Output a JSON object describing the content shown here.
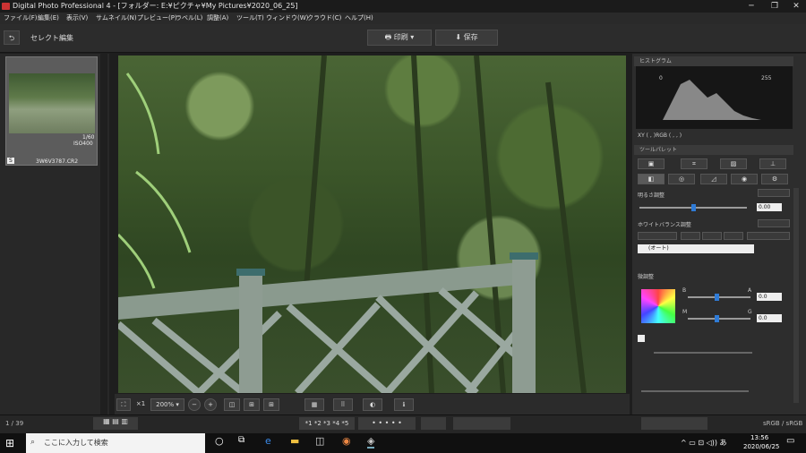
{
  "window": {
    "title": "Digital Photo Professional 4 - [フォルダー: E:¥ピクチャ¥My Pictures¥2020_06_25]"
  },
  "menu": [
    "ファイル(F)",
    "編集(E)",
    "表示(V)",
    "サムネイル(N)",
    "プレビュー(P)",
    "ラベル(L)",
    "調整(A)",
    "ツール(T)",
    "ウィンドウ(W)",
    "クラウド(C)",
    "ヘルプ(H)"
  ],
  "toolbar": {
    "mode_label": "セレクト編集",
    "print_label": "印刷",
    "save_label": "保存"
  },
  "thumbnail": {
    "filename": "3W6V3787.CR2",
    "shutter": "1/60",
    "iso": "ISO400",
    "badge": "S"
  },
  "histogram": {
    "title": "ヒストグラム",
    "min_label": "0",
    "max_label": "255",
    "xy_text": "XY (    ,     )RGB (    ,    ,    )"
  },
  "tool_palette": {
    "title": "ツールパレット"
  },
  "brightness": {
    "label": "明るさ調整",
    "value": "0.00",
    "level": 0.5
  },
  "white_balance": {
    "label": "ホワイトバランス調整",
    "mode": "(オート)"
  },
  "fine_tune": {
    "label": "微調整",
    "b_label": "B",
    "a_label": "A",
    "m_label": "M",
    "g_label": "G",
    "a_value": "0.0",
    "g_value": "0.0"
  },
  "viewer_bar": {
    "fit_label": "×1",
    "zoom": "200%"
  },
  "status": {
    "count": "1 / 39",
    "colorspace": "sRGB / sRGB"
  },
  "bottom_stars": "*1 *2 *3 *4 *5",
  "taskbar": {
    "search_placeholder": "ここに入力して検索",
    "time": "13:56",
    "date": "2020/06/25"
  }
}
